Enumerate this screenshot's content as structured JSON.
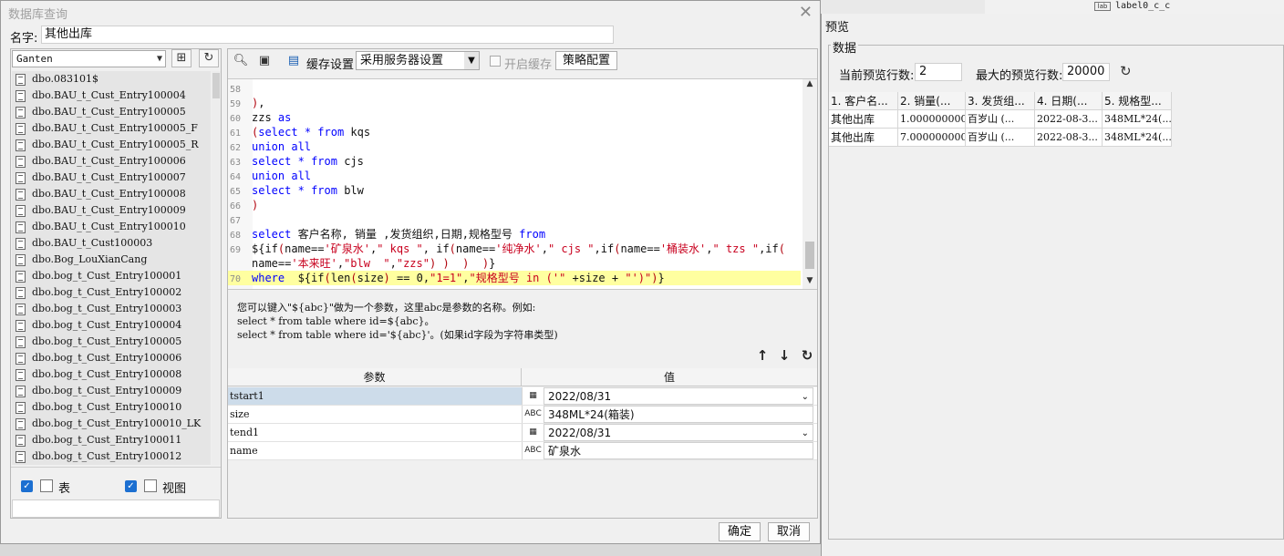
{
  "background": {
    "label_text": "label0_c_c",
    "label_icon": "lab"
  },
  "dialog": {
    "title": "数据库查询",
    "name_label": "名字:",
    "name_value": "其他出库"
  },
  "left_panel": {
    "db_selected": "Ganten",
    "tables": [
      "dbo.083101$",
      "dbo.BAU_t_Cust_Entry100004",
      "dbo.BAU_t_Cust_Entry100005",
      "dbo.BAU_t_Cust_Entry100005_F",
      "dbo.BAU_t_Cust_Entry100005_R",
      "dbo.BAU_t_Cust_Entry100006",
      "dbo.BAU_t_Cust_Entry100007",
      "dbo.BAU_t_Cust_Entry100008",
      "dbo.BAU_t_Cust_Entry100009",
      "dbo.BAU_t_Cust_Entry100010",
      "dbo.BAU_t_Cust100003",
      "dbo.Bog_LouXianCang",
      "dbo.bog_t_Cust_Entry100001",
      "dbo.bog_t_Cust_Entry100002",
      "dbo.bog_t_Cust_Entry100003",
      "dbo.bog_t_Cust_Entry100004",
      "dbo.bog_t_Cust_Entry100005",
      "dbo.bog_t_Cust_Entry100006",
      "dbo.bog_t_Cust_Entry100008",
      "dbo.bog_t_Cust_Entry100009",
      "dbo.bog_t_Cust_Entry100010",
      "dbo.bog_t_Cust_Entry100010_LK",
      "dbo.bog_t_Cust_Entry100011",
      "dbo.bog_t_Cust_Entry100012"
    ],
    "checkbox_table_label": "表",
    "checkbox_view_label": "视图"
  },
  "toolbar": {
    "cache_label": "缓存设置",
    "cache_value": "采用服务器设置",
    "enable_cache_label": "开启缓存",
    "policy_button": "策略配置"
  },
  "editor": {
    "lines": [
      {
        "n": "58",
        "t": ""
      },
      {
        "n": "59",
        "t": "),"
      },
      {
        "n": "60",
        "t": "zzs as"
      },
      {
        "n": "61",
        "t": "(select * from kqs"
      },
      {
        "n": "62",
        "t": "union all"
      },
      {
        "n": "63",
        "t": "select * from cjs"
      },
      {
        "n": "64",
        "t": "union all"
      },
      {
        "n": "65",
        "t": "select * from blw"
      },
      {
        "n": "66",
        "t": ")"
      },
      {
        "n": "67",
        "t": ""
      },
      {
        "n": "68",
        "t": "select 客户名称, 销量 ,发货组织,日期,规格型号 from"
      },
      {
        "n": "69",
        "t": "${if(name=='矿泉水',\" kqs \", if(name=='纯净水',\" cjs \",if(name=='桶装水',\" tzs \",if("
      },
      {
        "n": "",
        "t": "name=='本来旺',\"blw  \",\"zzs\") )  )  )}"
      },
      {
        "n": "70",
        "t": "where  ${if(len(size) == 0,\"1=1\",\"规格型号 in ('\" +size + \"')\")}"
      }
    ]
  },
  "hint": {
    "line1": "您可以键入\"${abc}\"做为一个参数，这里abc是参数的名称。例如:",
    "line2": "select * from table where id=${abc}。",
    "line3": "select * from table where id='${abc}'。(如果id字段为字符串类型)"
  },
  "params": {
    "col_param": "参数",
    "col_value": "值",
    "rows": [
      {
        "name": "tstart1",
        "type_icon": "calendar-icon",
        "value": "2022/08/31",
        "dropdown": true
      },
      {
        "name": "size",
        "type_icon": "text-type-icon",
        "value": "348ML*24(箱装)",
        "dropdown": false
      },
      {
        "name": "tend1",
        "type_icon": "calendar-icon",
        "value": "2022/08/31",
        "dropdown": true
      },
      {
        "name": "name",
        "type_icon": "text-type-icon",
        "value": "矿泉水",
        "dropdown": false
      }
    ]
  },
  "buttons": {
    "ok": "确定",
    "cancel": "取消"
  },
  "preview": {
    "title": "预览",
    "group_label": "数据",
    "current_rows_label": "当前预览行数:",
    "current_rows_value": "2",
    "max_rows_label": "最大的预览行数:",
    "max_rows_value": "20000",
    "columns": [
      "1. 客户名...",
      "2. 销量(...",
      "3. 发货组...",
      "4. 日期(...",
      "5. 规格型..."
    ],
    "rows": [
      [
        "其他出库",
        "1.0000000000",
        "百岁山 (...",
        "2022-08-3...",
        "348ML*24(..."
      ],
      [
        "其他出库",
        "7.0000000000",
        "百岁山 (...",
        "2022-08-3...",
        "348ML*24(..."
      ]
    ]
  }
}
